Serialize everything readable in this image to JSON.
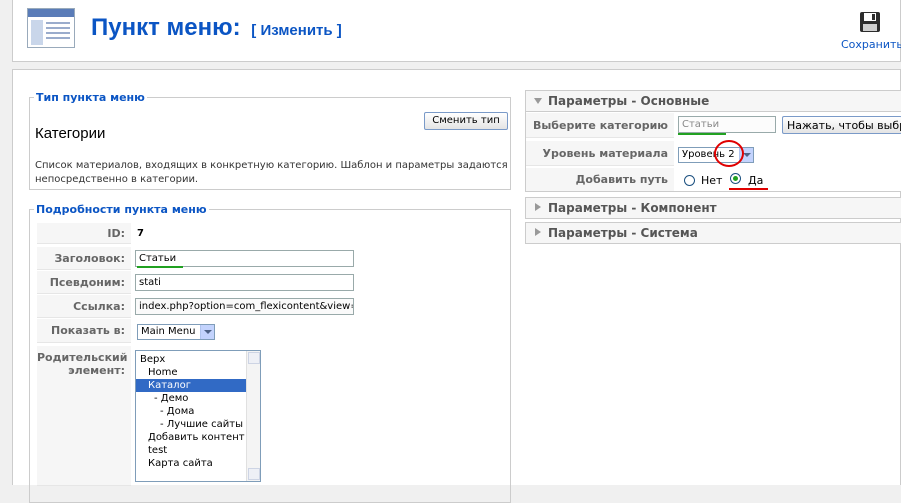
{
  "header": {
    "title": "Пункт меню:",
    "subtitle": "[ Изменить ]",
    "save_label": "Сохранить",
    "icon": "menu-item-icon"
  },
  "menu_type": {
    "legend": "Тип пункта меню",
    "name": "Категории",
    "change_button": "Сменить тип",
    "description_line1": "Список материалов, входящих в конкретную категорию. Шаблон и параметры задаются",
    "description_line2": "непосредственно в категории."
  },
  "details": {
    "legend": "Подробности пункта меню",
    "id_label": "ID:",
    "id_value": "7",
    "title_label": "Заголовок:",
    "title_value": "Статьи",
    "alias_label": "Псевдоним:",
    "alias_value": "stati",
    "link_label": "Ссылка:",
    "link_value": "index.php?option=com_flexicontent&view=cate",
    "show_in_label": "Показать в:",
    "show_in_value": "Main Menu",
    "parent_label_line1": "Родительский",
    "parent_label_line2": "элемент:",
    "parent_options": [
      "Верх",
      "Home",
      "Каталог",
      "- Демо",
      "- Дома",
      "- Лучшие сайты",
      "Добавить контент",
      "test",
      "Карта сайта"
    ],
    "parent_selected": "Каталог"
  },
  "params_basic": {
    "header": "Параметры - Основные",
    "category_label": "Выберите категорию",
    "category_value": "Статьи",
    "category_button": "Нажать, чтобы выбрать",
    "level_label": "Уровень материала",
    "level_value": "Уровень 2",
    "path_label": "Добавить путь",
    "path_no": "Нет",
    "path_yes": "Да",
    "path_selected": "Да"
  },
  "params_component": {
    "header": "Параметры - Компонент"
  },
  "params_system": {
    "header": "Параметры - Система"
  },
  "colors": {
    "title_blue": "#0b55c4",
    "highlight_green": "#21a121",
    "annotation_red": "#e00000",
    "selection_blue": "#316ac5"
  }
}
